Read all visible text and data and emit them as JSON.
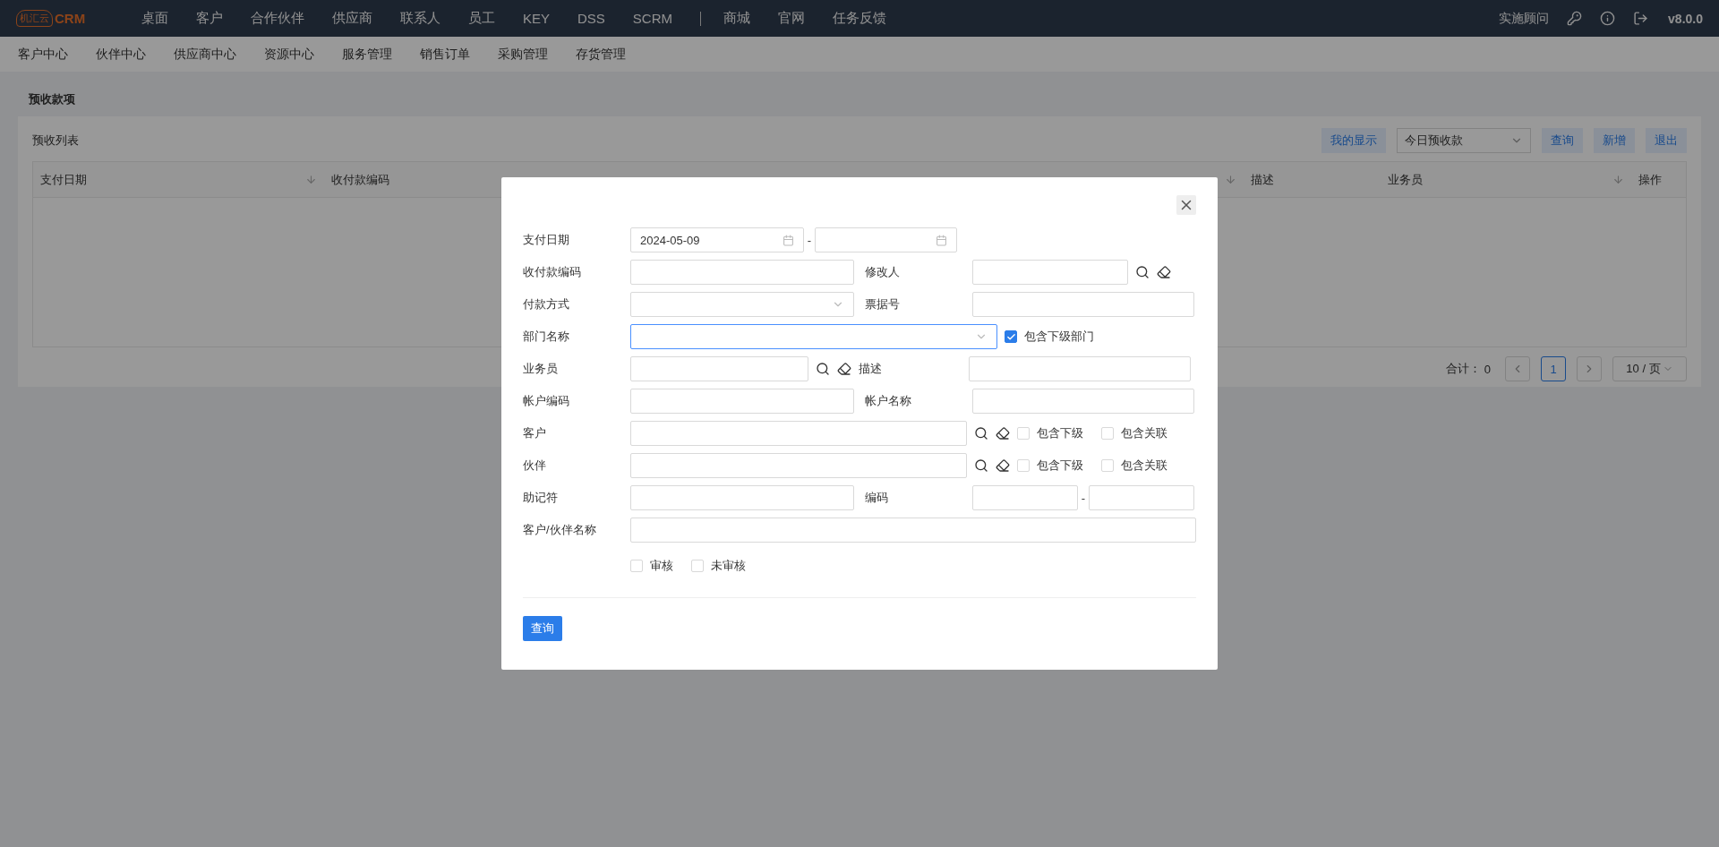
{
  "logo": {
    "badge": "机汇云",
    "name": "CRM"
  },
  "top_nav": [
    "桌面",
    "客户",
    "合作伙伴",
    "供应商",
    "联系人",
    "员工",
    "KEY",
    "DSS",
    "SCRM"
  ],
  "top_nav_extra": [
    "商城",
    "官网",
    "任务反馈"
  ],
  "user_role": "实施顾问",
  "version": "v8.0.0",
  "sub_nav": [
    "客户中心",
    "伙伴中心",
    "供应商中心",
    "资源中心",
    "服务管理",
    "销售订单",
    "采购管理",
    "存货管理"
  ],
  "page_title": "预收款项",
  "list": {
    "title": "预收列表",
    "display_button": "我的显示",
    "filter_value": "今日预收款",
    "buttons": [
      "查询",
      "新增",
      "退出"
    ],
    "columns": [
      {
        "label": "支付日期",
        "sortable": true
      },
      {
        "label": "收付款编码"
      },
      {},
      {
        "sortable": true
      },
      {
        "label": "描述",
        "sortable": false
      },
      {
        "label": "业务员",
        "sortable": true
      },
      {
        "label": "操作",
        "sortable": false
      }
    ],
    "total_label": "合计：",
    "total": "0",
    "pages": [
      {
        "label": "1",
        "selected": true
      }
    ],
    "page_size": "10 / 页"
  },
  "dialog": {
    "rows": [
      {
        "kind": "daterange",
        "label": "支付日期",
        "value": "2024-05-09",
        "separator": "-"
      },
      {
        "kind": "pair_lookup",
        "label": "收付款编码",
        "label2": "修改人"
      },
      {
        "kind": "select_pair",
        "label": "付款方式",
        "label2": "票据号"
      },
      {
        "kind": "select_wide",
        "label": "部门名称",
        "focused": true,
        "checks": [
          {
            "label": "包含下级部门",
            "checked": true
          }
        ]
      },
      {
        "kind": "lookup_pair",
        "label": "业务员",
        "label2": "描述"
      },
      {
        "kind": "pair",
        "label": "帐户编码",
        "label2": "帐户名称"
      },
      {
        "kind": "lookup_wide",
        "label": "客户",
        "checks": [
          {
            "label": "包含下级",
            "checked": false
          },
          {
            "label": "包含关联",
            "checked": false
          }
        ]
      },
      {
        "kind": "lookup_wide",
        "label": "伙伴",
        "checks": [
          {
            "label": "包含下级",
            "checked": false
          },
          {
            "label": "包含关联",
            "checked": false
          }
        ]
      },
      {
        "kind": "range_pair",
        "label": "助记符",
        "label2": "编码",
        "separator": "-"
      },
      {
        "kind": "full",
        "label": "客户/伙伴名称"
      },
      {
        "kind": "checks",
        "checks": [
          {
            "label": "审核",
            "checked": false
          },
          {
            "label": "未审核",
            "checked": false
          }
        ]
      }
    ],
    "submit": "查询"
  }
}
